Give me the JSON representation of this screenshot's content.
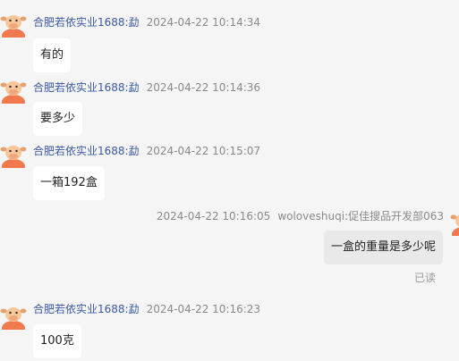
{
  "messages": [
    {
      "sender": "合肥若依实业1688:勐",
      "time": "2024-04-22 10:14:34",
      "text": "有的",
      "avatar": "cow-avatar-icon"
    },
    {
      "sender": "合肥若依实业1688:勐",
      "time": "2024-04-22 10:14:36",
      "text": "要多少",
      "avatar": "cow-avatar-icon"
    },
    {
      "sender": "合肥若依实业1688:勐",
      "time": "2024-04-22 10:15:07",
      "text": "一箱192盒",
      "avatar": "cow-avatar-icon"
    },
    {
      "sender": "woloveshuqi:促佳搜品开发部063",
      "time": "2024-04-22 10:16:05",
      "text": "一盒的重量是多少呢",
      "status": "已读",
      "avatar": "cow-avatar-icon"
    },
    {
      "sender": "合肥若依实业1688:勐",
      "time": "2024-04-22 10:16:23",
      "text": "100克",
      "avatar": "cow-avatar-icon"
    }
  ],
  "colors": {
    "background": "#f5f5f5",
    "sender_name": "#3b5aa3",
    "timestamp": "#8a8a8a",
    "bubble_incoming": "#ffffff",
    "bubble_outgoing": "#e9e9e9"
  }
}
